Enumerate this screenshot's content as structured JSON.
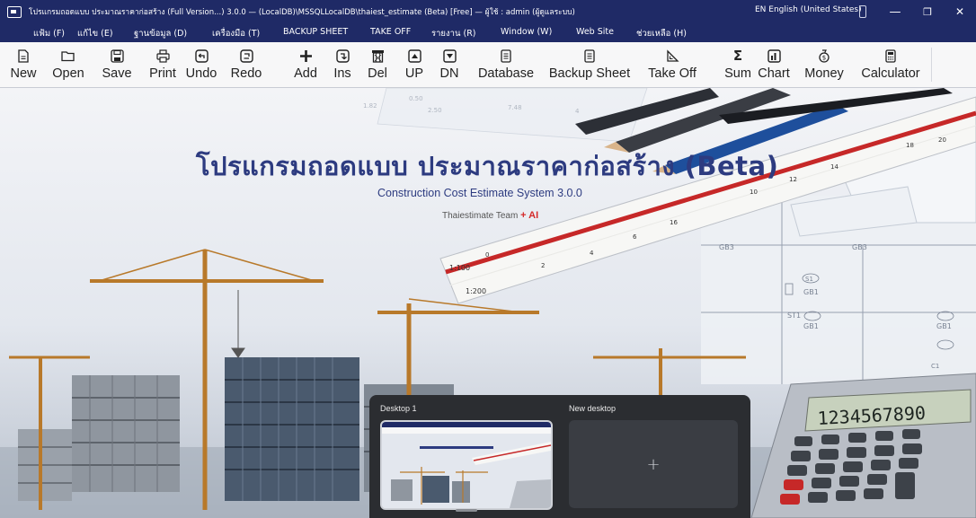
{
  "window": {
    "title": "โปรแกรมถอดแบบ ประมาณราคาก่อสร้าง (Full Version...) 3.0.0 — (LocalDB)\\MSSQLLocalDB\\thaiest_estimate (Beta)  [Free] — ผู้ใช้ : admin (ผู้ดูแลระบบ)",
    "language": "EN English (United States)",
    "minimize": "—",
    "restore": "❐",
    "close": "✕"
  },
  "menu": [
    "แฟ้ม (F)",
    "แก้ไข (E)",
    "ฐานข้อมูล (D)",
    "เครื่องมือ (T)",
    "BACKUP SHEET",
    "TAKE OFF",
    "รายงาน (R)",
    "Window (W)",
    "Web Site",
    "ช่วยเหลือ (H)"
  ],
  "toolbar": [
    {
      "label": "New",
      "icon": "new-document-icon"
    },
    {
      "label": "Open",
      "icon": "folder-open-icon"
    },
    {
      "label": "Save",
      "icon": "save-icon"
    },
    {
      "label": "Print",
      "icon": "print-icon"
    },
    {
      "label": "Undo",
      "icon": "undo-icon"
    },
    {
      "label": "Redo",
      "icon": "redo-icon"
    },
    {
      "label": "Add",
      "icon": "add-icon"
    },
    {
      "label": "Ins",
      "icon": "insert-icon"
    },
    {
      "label": "Del",
      "icon": "delete-icon"
    },
    {
      "label": "UP",
      "icon": "move-up-icon"
    },
    {
      "label": "DN",
      "icon": "move-down-icon"
    },
    {
      "label": "Database",
      "icon": "database-icon"
    },
    {
      "label": "Backup Sheet",
      "icon": "backup-sheet-icon"
    },
    {
      "label": "Take Off",
      "icon": "take-off-icon"
    },
    {
      "label": "Sum",
      "icon": "sum-icon"
    },
    {
      "label": "Chart",
      "icon": "chart-icon"
    },
    {
      "label": "Money",
      "icon": "money-icon"
    },
    {
      "label": "Calculator",
      "icon": "calculator-icon"
    }
  ],
  "hero": {
    "title": "โปรแกรมถอดแบบ ประมาณราคาก่อสร้าง (Beta)",
    "subtitle": "Construction Cost Estimate System 3.0.0",
    "team": "Thaiestimate Team",
    "team_ai": "+ AI"
  },
  "calculator_display": "1234567890",
  "taskview": {
    "desktop1": "Desktop 1",
    "new_desktop": "New desktop",
    "add": "+"
  },
  "colors": {
    "titlebar": "#1f2a66",
    "hero_title": "#2d3b80",
    "ai_red": "#d42a2a",
    "ruler_red": "#c62828"
  }
}
